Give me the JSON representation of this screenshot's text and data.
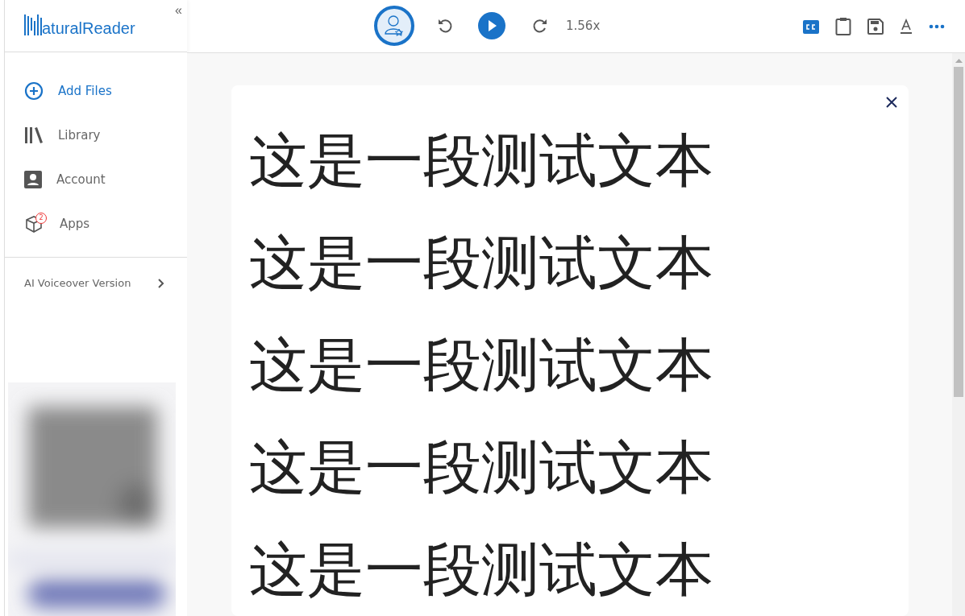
{
  "sidebar": {
    "logo": {
      "text": "aturalReader"
    },
    "collapse": "«",
    "items": [
      {
        "kind": "add",
        "label": "Add Files",
        "selected": true
      },
      {
        "kind": "library",
        "label": "Library",
        "selected": false
      },
      {
        "kind": "account",
        "label": "Account",
        "selected": false
      },
      {
        "kind": "apps",
        "label": "Apps",
        "selected": false,
        "badge": "2"
      }
    ],
    "version_link": "AI Voiceover Version"
  },
  "toolbar": {
    "speed": "1.56x"
  },
  "document": {
    "paragraphs": [
      "这是一段测试文本",
      "这是一段测试文本",
      "这是一段测试文本",
      "这是一段测试文本",
      "这是一段测试文本"
    ]
  }
}
